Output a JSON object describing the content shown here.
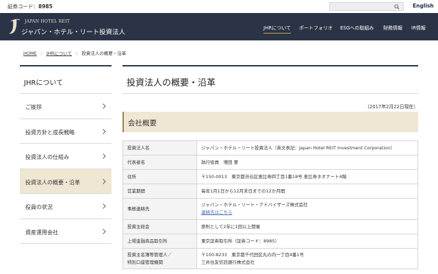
{
  "topbar": {
    "code_label": "証券コード：",
    "code_value": "8985",
    "search_placeholder": "",
    "language_link": "English"
  },
  "header": {
    "logo_en": "JAPAN HOTEL REIT",
    "logo_jp": "ジャパン・ホテル・リート投資法人",
    "nav": [
      {
        "label": "JHRについて",
        "active": true
      },
      {
        "label": "ポートフォリオ"
      },
      {
        "label": "ESGへの取組み"
      },
      {
        "label": "財務情報"
      },
      {
        "label": "IR情報"
      }
    ]
  },
  "breadcrumb": [
    "HOME",
    "JHRについて",
    "投資法人の概要・沿革"
  ],
  "sidebar": {
    "title": "JHRについて",
    "items": [
      {
        "label": "ご挨拶"
      },
      {
        "label": "投資方針と成長戦略"
      },
      {
        "label": "投資法人の仕組み"
      },
      {
        "label": "投資法人の概要・沿革",
        "active": true
      },
      {
        "label": "役員の状況"
      },
      {
        "label": "資産運用会社"
      }
    ]
  },
  "main": {
    "title": "投資法人の概要・沿革",
    "date_note": "（2017年2月22日現在）",
    "section_title": "会社概要",
    "rows": [
      {
        "key": "投資法人名",
        "value": "ジャパン・ホテル・リート投資法人（英文表記：Japan Hotel REIT Investment Corporation）"
      },
      {
        "key": "代表者名",
        "value": "執行役員　増田 要"
      },
      {
        "key": "住所",
        "value": "〒150-0013　東京都渋谷区恵比寿四丁目1番18号 恵比寿ネオナート4階"
      },
      {
        "key": "営業期間",
        "value": "毎年1月1日から12月末日までの12か月間"
      },
      {
        "key": "事務連絡先",
        "value": "ジャパン・ホテル・リート・アドバイザーズ株式会社",
        "link": "連絡先はこちら"
      },
      {
        "key": "投資主総会",
        "value": "原則として2年に1回以上開催"
      },
      {
        "key": "上場金融商品取引所",
        "value": "東京証券取引所（証券コード：8985）"
      },
      {
        "key": "投資主名簿等管理人／",
        "key2": "特別口座管理機関",
        "value": "〒100-8233　東京都千代田区丸の内一丁目4番1号",
        "value2": "三井住友信託銀行株式会社"
      }
    ]
  },
  "colors": {
    "header_bg": "#2b3446",
    "accent_beige": "#f0e6d4",
    "accent_gold": "#c8a85a"
  }
}
